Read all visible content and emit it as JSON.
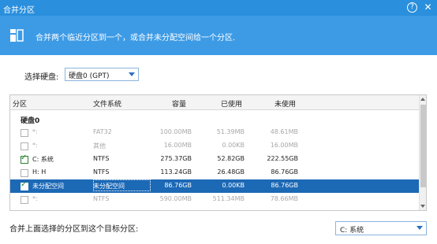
{
  "window": {
    "title": "合并分区",
    "help_icon": "?",
    "close_icon": "✕"
  },
  "banner": {
    "text": "合并两个临近分区到一个，或合并未分配空间给一个分区."
  },
  "disk_selector": {
    "label": "选择硬盘:",
    "value": "硬盘0 (GPT)"
  },
  "table": {
    "headers": [
      "分区",
      "文件系统",
      "容量",
      "已使用",
      "未使用"
    ],
    "group_label": "硬盘0",
    "rows": [
      {
        "name": "*:",
        "fs": "FAT32",
        "capacity": "100.00MB",
        "used": "51.39MB",
        "unused": "48.61MB",
        "checked": false,
        "dim": true
      },
      {
        "name": "*:",
        "fs": "其他",
        "capacity": "16.00MB",
        "used": "0.00KB",
        "unused": "16.00MB",
        "checked": false,
        "dim": true
      },
      {
        "name": "C: 系统",
        "fs": "NTFS",
        "capacity": "275.37GB",
        "used": "52.82GB",
        "unused": "222.55GB",
        "checked": true,
        "dim": false
      },
      {
        "name": "H: H",
        "fs": "NTFS",
        "capacity": "113.24GB",
        "used": "26.48GB",
        "unused": "86.76GB",
        "checked": false,
        "dim": false
      },
      {
        "name": "未分配空间",
        "fs": "未分配空间",
        "capacity": "86.76GB",
        "used": "0.00KB",
        "unused": "86.76GB",
        "checked": true,
        "dim": false,
        "selected": true
      },
      {
        "name": "*:",
        "fs": "NTFS",
        "capacity": "590.00MB",
        "used": "511.34MB",
        "unused": "78.66MB",
        "checked": false,
        "dim": true
      }
    ]
  },
  "merge_target": {
    "label": "合并上面选择的分区到这个目标分区:",
    "value": "C: 系统"
  }
}
